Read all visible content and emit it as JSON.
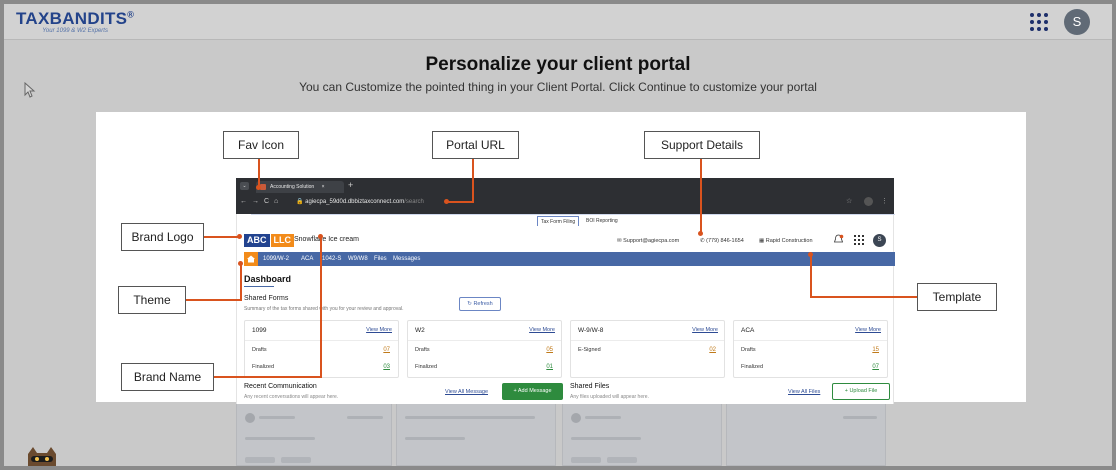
{
  "header": {
    "logo_text": "TAXBANDITS",
    "logo_tagline": "Your 1099 & W2 Experts",
    "avatar_initial": "S"
  },
  "page": {
    "title": "Personalize your client portal",
    "subtitle": "You can Customize the pointed thing in your Client Portal. Click Continue to customize your portal"
  },
  "callouts": {
    "fav_icon": "Fav Icon",
    "portal_url": "Portal URL",
    "support_details": "Support Details",
    "brand_logo": "Brand Logo",
    "theme": "Theme",
    "template": "Template",
    "brand_name": "Brand Name"
  },
  "browser": {
    "tab_title": "Accounting Solution",
    "tab_close": "×",
    "new_tab": "+",
    "url_main": "agiecpa_59d0d.dbbiztaxconnect.com",
    "url_path": "/search"
  },
  "portal": {
    "top_tabs": [
      "Tax Form Filing",
      "BOI Reporting"
    ],
    "brand_part1": "ABC",
    "brand_part2": "LLC",
    "brand_name": "Snowflake Ice cream",
    "support_email": "Support@agiecpa.com",
    "support_phone": "(779) 846-1654",
    "company": "Rapid Construction",
    "user_initial": "S",
    "menu": [
      "1099/W-2",
      "ACA",
      "1042-S",
      "W9/W8",
      "Files",
      "Messages"
    ],
    "dashboard_title": "Dashboard",
    "shared_forms_title": "Shared Forms",
    "shared_forms_sub": "Summary of the tax forms shared with you for your review and approval.",
    "refresh_label": "Refresh",
    "form_cards": [
      {
        "title": "1099",
        "view_more": "View More",
        "rows": [
          {
            "label": "Drafts",
            "value": "07"
          },
          {
            "label": "Finalized",
            "value": "03"
          }
        ]
      },
      {
        "title": "W2",
        "view_more": "View More",
        "rows": [
          {
            "label": "Drafts",
            "value": "05"
          },
          {
            "label": "Finalized",
            "value": "01"
          }
        ]
      },
      {
        "title": "W-9/W-8",
        "view_more": "View More",
        "rows": [
          {
            "label": "E-Signed",
            "value": "02"
          }
        ]
      },
      {
        "title": "ACA",
        "view_more": "View More",
        "rows": [
          {
            "label": "Drafts",
            "value": "15"
          },
          {
            "label": "Finalized",
            "value": "07"
          }
        ]
      }
    ],
    "recent_comm_title": "Recent Communication",
    "recent_comm_sub": "Any recent conversations will appear here.",
    "view_all_message": "View All Message",
    "add_message": "+ Add Message",
    "shared_files_title": "Shared Files",
    "shared_files_sub": "Any files uploaded will appear here.",
    "view_all_files": "View All Files",
    "upload_file": "+ Upload File"
  },
  "colors": {
    "accent": "#d9531e",
    "brand_blue": "#22438f",
    "brand_orange": "#f28b1a",
    "menu_bar": "#4768a5",
    "green": "#2e8b3e"
  }
}
